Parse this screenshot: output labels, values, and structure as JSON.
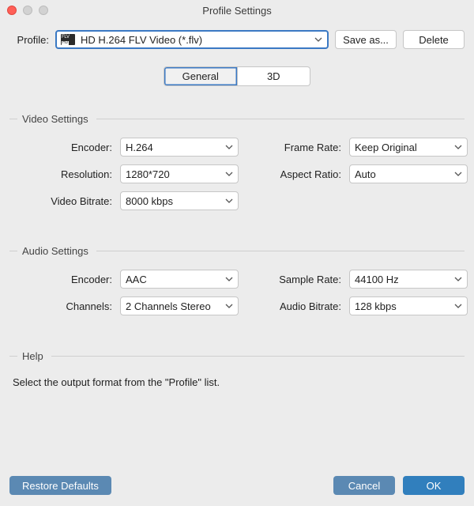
{
  "window": {
    "title": "Profile Settings"
  },
  "profile": {
    "label": "Profile:",
    "value": "HD H.264 FLV Video (*.flv)"
  },
  "buttons": {
    "save_as": "Save as...",
    "delete": "Delete",
    "restore": "Restore Defaults",
    "cancel": "Cancel",
    "ok": "OK"
  },
  "tabs": {
    "general": "General",
    "threeD": "3D"
  },
  "video": {
    "section": "Video Settings",
    "encoder_label": "Encoder:",
    "encoder": "H.264",
    "resolution_label": "Resolution:",
    "resolution": "1280*720",
    "bitrate_label": "Video Bitrate:",
    "bitrate": "8000 kbps",
    "framerate_label": "Frame Rate:",
    "framerate": "Keep Original",
    "aspect_label": "Aspect Ratio:",
    "aspect": "Auto"
  },
  "audio": {
    "section": "Audio Settings",
    "encoder_label": "Encoder:",
    "encoder": "AAC",
    "channels_label": "Channels:",
    "channels": "2 Channels Stereo",
    "samplerate_label": "Sample Rate:",
    "samplerate": "44100 Hz",
    "bitrate_label": "Audio Bitrate:",
    "bitrate": "128 kbps"
  },
  "help": {
    "section": "Help",
    "text": "Select the output format from the \"Profile\" list."
  }
}
